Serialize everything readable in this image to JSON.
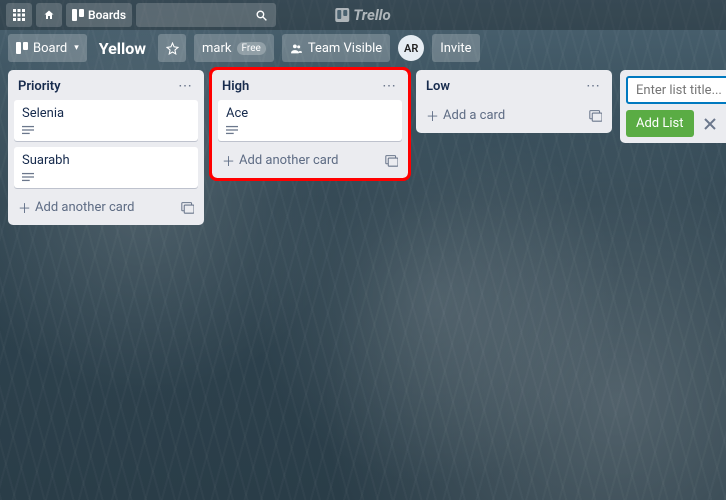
{
  "globalHeader": {
    "boardsLabel": "Boards",
    "logoText": "Trello"
  },
  "boardHeader": {
    "boardButtonLabel": "Board",
    "boardName": "Yellow",
    "owner": "mark",
    "ownerBadge": "Free",
    "visibility": "Team Visible",
    "inviteLabel": "Invite",
    "avatarInitials": "AR"
  },
  "lists": {
    "priority": {
      "title": "Priority",
      "cards": [
        "Selenia",
        "Suarabh"
      ],
      "addAnother": "Add another card"
    },
    "high": {
      "title": "High",
      "cards": [
        "Ace"
      ],
      "addAnother": "Add another card"
    },
    "low": {
      "title": "Low",
      "addCard": "Add a card"
    }
  },
  "composer": {
    "placeholder": "Enter list title...",
    "addListLabel": "Add List"
  }
}
